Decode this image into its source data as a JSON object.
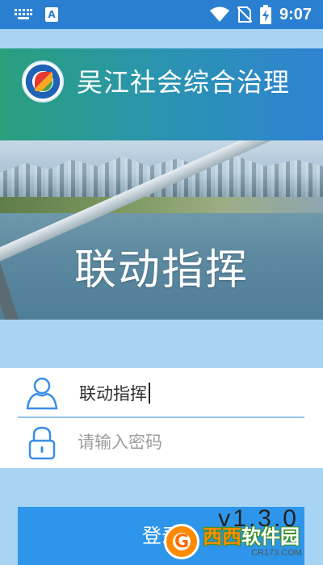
{
  "status_bar": {
    "time": "9:07",
    "left_icons": [
      "keyboard-icon",
      "accessibility-a-icon"
    ],
    "right_icons": [
      "wifi-icon",
      "no-sim-icon",
      "battery-charging-icon"
    ]
  },
  "header": {
    "app_title": "吴江社会综合治理",
    "logo_icon": "app-logo-icon"
  },
  "banner": {
    "title": "联动指挥"
  },
  "login_form": {
    "username_value": "联动指挥",
    "password_placeholder": "请输入密码",
    "username_icon": "user-icon",
    "password_icon": "lock-icon"
  },
  "login_button": {
    "label": "登录"
  },
  "version": "v1.3.0",
  "watermark": {
    "main_left": "西西",
    "main_right": "软件园",
    "sub": "CR173.COM"
  },
  "colors": {
    "status_bar": "#2a7fd0",
    "header_start": "#2aa07c",
    "header_end": "#2f83d2",
    "page_bg": "#a8d4f4",
    "button": "#2e96ea",
    "icon_blue": "#3a8ee6"
  }
}
